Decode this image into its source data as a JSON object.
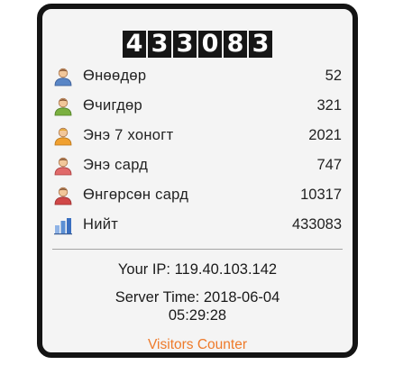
{
  "counter": {
    "digits": [
      "4",
      "3",
      "3",
      "0",
      "8",
      "3"
    ]
  },
  "stats": [
    {
      "label": "Өнөөдөр",
      "value": "52",
      "icon": "user-icon",
      "color": "#e8913a"
    },
    {
      "label": "Өчигдөр",
      "value": "321",
      "icon": "user-icon",
      "color": "#7ba83a"
    },
    {
      "label": "Энэ 7 хоногт",
      "value": "2021",
      "icon": "user-icon",
      "color": "#f0a030"
    },
    {
      "label": "Энэ сард",
      "value": "747",
      "icon": "user-icon",
      "color": "#d9534f"
    },
    {
      "label": "Өнгөрсөн сард",
      "value": "10317",
      "icon": "user-icon",
      "color": "#cc4444"
    },
    {
      "label": "Нийт",
      "value": "433083",
      "icon": "bar-chart-icon",
      "color": "#5b8fd4"
    }
  ],
  "info": {
    "ip": "Your IP: 119.40.103.142",
    "server_time_line1": "Server Time: 2018-06-04",
    "server_time_line2": "05:29:28"
  },
  "footer": {
    "link": "Visitors Counter",
    "link_color": "#ee7a2a"
  }
}
